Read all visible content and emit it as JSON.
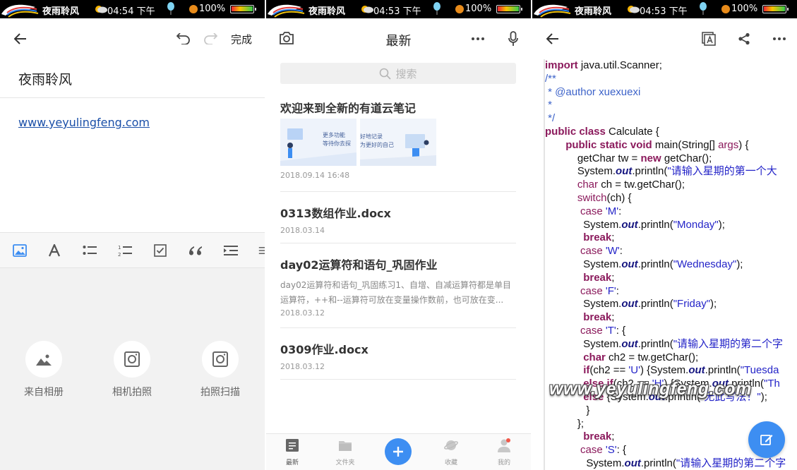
{
  "statusbars": [
    {
      "name": "夜雨聆风",
      "time": "04:54 下午",
      "battery": "100%"
    },
    {
      "name": "夜雨聆风",
      "time": "04:53 下午",
      "battery": "100%"
    },
    {
      "name": "夜雨聆风",
      "time": "04:53 下午",
      "battery": "100%"
    }
  ],
  "editor": {
    "done_label": "完成",
    "title": "夜雨聆风",
    "link": "www.yeyulingfeng.com",
    "insert_options": [
      {
        "label": "来自相册",
        "icon": "image-icon"
      },
      {
        "label": "相机拍照",
        "icon": "camera-icon"
      },
      {
        "label": "拍照扫描",
        "icon": "scan-icon"
      }
    ],
    "format_tools": [
      "image-icon",
      "text-format-icon",
      "bullet-list-icon",
      "numbered-list-icon",
      "checkbox-icon",
      "quote-icon",
      "indent-icon"
    ]
  },
  "list": {
    "header_title": "最新",
    "search_placeholder": "搜索",
    "notes": [
      {
        "title": "欢迎来到全新的有道云笔记",
        "date": "2018.09.14 16:48",
        "thumbs": [
          "更多功能\n等待你去探",
          "好地记录\n为更好的自己"
        ]
      },
      {
        "title": "0313数组作业.docx",
        "date": "2018.03.14"
      },
      {
        "title": "day02运算符和语句_巩固作业",
        "desc": "day02运算符和语句_巩固练习1、自增、自减运算符都是单目运算符，++和--运算符可放在变量操作数前，也可放在变...",
        "date": "2018.03.12"
      },
      {
        "title": "0309作业.docx",
        "date": "2018.03.12"
      }
    ],
    "tabs": [
      {
        "label": "最新",
        "active": true
      },
      {
        "label": "文件夹",
        "active": false
      },
      {
        "label": "收藏",
        "active": false
      },
      {
        "label": "我的",
        "active": false
      }
    ],
    "accent": "#3d8ef2"
  },
  "code_view": {
    "lines": [
      [
        [
          "kw",
          "import"
        ],
        [
          "t",
          " java.util.Scanner;"
        ]
      ],
      [
        [
          "cm",
          "/**"
        ]
      ],
      [
        [
          "cm",
          " * @author xuexuexi"
        ]
      ],
      [
        [
          "cm",
          " *"
        ]
      ],
      [
        [
          "cm",
          " */"
        ]
      ],
      [
        [
          "kw",
          "public class"
        ],
        [
          "t",
          " Calculate {"
        ]
      ],
      [
        [
          "t",
          "       "
        ],
        [
          "kw",
          "public static void"
        ],
        [
          "t",
          " main(String[] "
        ],
        [
          "lt",
          "args"
        ],
        [
          "t",
          ") {"
        ]
      ],
      [
        [
          "t",
          "           getChar tw = "
        ],
        [
          "kw",
          "new"
        ],
        [
          "t",
          " getChar();"
        ]
      ],
      [
        [
          "t",
          "           System."
        ],
        [
          "fld",
          "out"
        ],
        [
          "t",
          ".println("
        ],
        [
          "str",
          "\"请输入星期的第一个大"
        ]
      ],
      [
        [
          "t",
          "           "
        ],
        [
          "lt",
          "char"
        ],
        [
          "t",
          " ch = tw.getChar();"
        ]
      ],
      [
        [
          "t",
          "           "
        ],
        [
          "lt",
          "switch"
        ],
        [
          "t",
          "(ch) {"
        ]
      ],
      [
        [
          "t",
          "            "
        ],
        [
          "lt",
          "case"
        ],
        [
          "t",
          " "
        ],
        [
          "str",
          "'M'"
        ],
        [
          "t",
          ":"
        ]
      ],
      [
        [
          "t",
          "             System."
        ],
        [
          "fld",
          "out"
        ],
        [
          "t",
          ".println("
        ],
        [
          "str",
          "\"Monday\""
        ],
        [
          "t",
          ");"
        ]
      ],
      [
        [
          "t",
          "             "
        ],
        [
          "kw",
          "break"
        ],
        [
          "t",
          ";"
        ]
      ],
      [
        [
          "t",
          "            "
        ],
        [
          "lt",
          "case"
        ],
        [
          "t",
          " "
        ],
        [
          "str",
          "'W'"
        ],
        [
          "t",
          ":"
        ]
      ],
      [
        [
          "t",
          "             System."
        ],
        [
          "fld",
          "out"
        ],
        [
          "t",
          ".println("
        ],
        [
          "str",
          "\"Wednesday\""
        ],
        [
          "t",
          ");"
        ]
      ],
      [
        [
          "t",
          "             "
        ],
        [
          "kw",
          "break"
        ],
        [
          "t",
          ";"
        ]
      ],
      [
        [
          "t",
          "            "
        ],
        [
          "lt",
          "case"
        ],
        [
          "t",
          " "
        ],
        [
          "str",
          "'F'"
        ],
        [
          "t",
          ":"
        ]
      ],
      [
        [
          "t",
          "             System."
        ],
        [
          "fld",
          "out"
        ],
        [
          "t",
          ".println("
        ],
        [
          "str",
          "\"Friday\""
        ],
        [
          "t",
          ");"
        ]
      ],
      [
        [
          "t",
          "             "
        ],
        [
          "kw",
          "break"
        ],
        [
          "t",
          ";"
        ]
      ],
      [
        [
          "t",
          "            "
        ],
        [
          "lt",
          "case"
        ],
        [
          "t",
          " "
        ],
        [
          "str",
          "'T'"
        ],
        [
          "t",
          ": {"
        ]
      ],
      [
        [
          "t",
          "             System."
        ],
        [
          "fld",
          "out"
        ],
        [
          "t",
          ".println("
        ],
        [
          "str",
          "\"请输入星期的第二个字"
        ]
      ],
      [
        [
          "t",
          "             "
        ],
        [
          "kw",
          "char"
        ],
        [
          "t",
          " ch2 = tw.getChar();"
        ]
      ],
      [
        [
          "t",
          "             "
        ],
        [
          "kw",
          "if"
        ],
        [
          "t",
          "(ch2 == "
        ],
        [
          "str",
          "'U'"
        ],
        [
          "t",
          ") {System."
        ],
        [
          "fld",
          "out"
        ],
        [
          "t",
          ".println("
        ],
        [
          "str",
          "\"Tuesda"
        ]
      ],
      [
        [
          "t",
          "             "
        ],
        [
          "kw",
          "else if"
        ],
        [
          "t",
          "(ch2 == "
        ],
        [
          "str",
          "'H'"
        ],
        [
          "t",
          ") {System."
        ],
        [
          "fld",
          "out"
        ],
        [
          "t",
          ".println("
        ],
        [
          "str",
          "\"Th"
        ]
      ],
      [
        [
          "t",
          "             "
        ],
        [
          "kw",
          "else"
        ],
        [
          "t",
          " {System."
        ],
        [
          "fld",
          "out"
        ],
        [
          "t",
          ".println("
        ],
        [
          "str",
          "\"无此写法！\""
        ],
        [
          "t",
          ");"
        ]
      ],
      [
        [
          "t",
          "              }"
        ]
      ],
      [
        [
          "t",
          "           };"
        ]
      ],
      [
        [
          "t",
          "             "
        ],
        [
          "kw",
          "break"
        ],
        [
          "t",
          ";"
        ]
      ],
      [
        [
          "t",
          "            "
        ],
        [
          "lt",
          "case"
        ],
        [
          "t",
          " "
        ],
        [
          "str",
          "'S'"
        ],
        [
          "t",
          ": {"
        ]
      ],
      [
        [
          "t",
          "              System."
        ],
        [
          "fld",
          "out"
        ],
        [
          "t",
          ".println("
        ],
        [
          "str",
          "\"请输入星期的第二个字"
        ]
      ]
    ],
    "watermark": "www.yeyulingfeng.com"
  }
}
